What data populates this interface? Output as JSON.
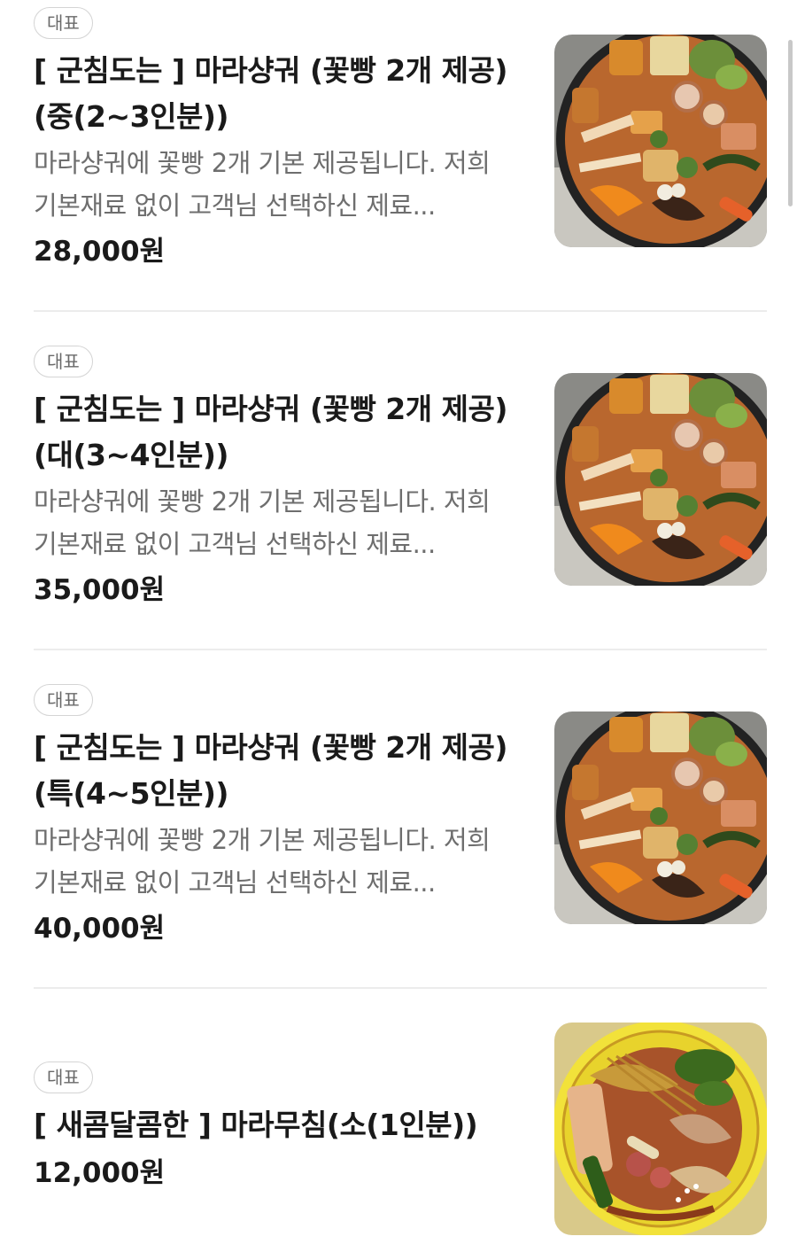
{
  "menu": {
    "items": [
      {
        "badge": "대표",
        "title": "[ 군침도는 ] 마라샹궈 (꽃빵 2개 제공)(중(2~3인분))",
        "description": "마라샹궈에 꽃빵 2개 기본 제공됩니다. 저희 기본재료 없이 고객님 선택하신 제료...",
        "price": "28,000원",
        "image": "mala-xiangguo-photo"
      },
      {
        "badge": "대표",
        "title": "[ 군침도는 ] 마라샹궈 (꽃빵 2개 제공)(대(3~4인분))",
        "description": "마라샹궈에 꽃빵 2개 기본 제공됩니다. 저희 기본재료 없이 고객님 선택하신 제료...",
        "price": "35,000원",
        "image": "mala-xiangguo-photo"
      },
      {
        "badge": "대표",
        "title": "[ 군침도는 ] 마라샹궈 (꽃빵 2개 제공)(특(4~5인분))",
        "description": "마라샹궈에 꽃빵 2개 기본 제공됩니다. 저희 기본재료 없이 고객님 선택하신 제료...",
        "price": "40,000원",
        "image": "mala-xiangguo-photo"
      },
      {
        "badge": "대표",
        "title": "[ 새콤달콤한 ] 마라무침(소(1인분))",
        "price": "12,000원",
        "image": "mala-muchim-photo"
      }
    ]
  },
  "colors": {
    "text_primary": "#1a1a1a",
    "text_secondary": "#6e6e6e",
    "badge_border": "#d4d4d4",
    "divider": "#ececec"
  }
}
